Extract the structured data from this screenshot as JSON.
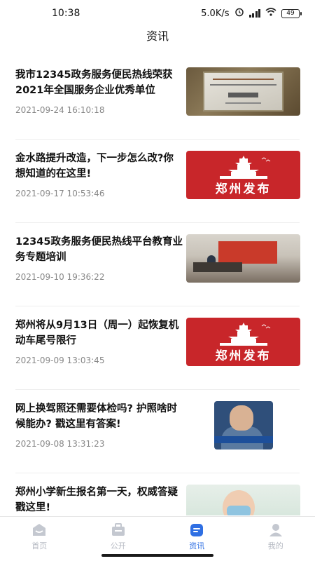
{
  "status_bar": {
    "time": "10:38",
    "net_speed": "5.0K/s",
    "battery": "49"
  },
  "header": {
    "title": "资讯"
  },
  "news": [
    {
      "title": "我市12345政务服务便民热线荣获2021年全国服务企业优秀单位",
      "time": "2021-09-24 16:10:18",
      "thumb": "plaque-photo"
    },
    {
      "title": "金水路提升改造，下一步怎么改?你想知道的在这里!",
      "time": "2021-09-17 10:53:46",
      "thumb": "zhengzhou-release-banner",
      "thumb_text": "郑州发布"
    },
    {
      "title": "12345政务服务便民热线平台教育业务专题培训",
      "time": "2021-09-10 19:36:22",
      "thumb": "meeting-hall-photo"
    },
    {
      "title": "郑州将从9月13日（周一）起恢复机动车尾号限行",
      "time": "2021-09-09 13:03:45",
      "thumb": "zhengzhou-release-banner",
      "thumb_text": "郑州发布"
    },
    {
      "title": "网上换驾照还需要体检吗? 护照啥时候能办? 戳这里有答案!",
      "time": "2021-09-08 13:31:23",
      "thumb": "police-poster"
    },
    {
      "title": "郑州小学新生报名第一天，权威答疑戳这里!",
      "time": "",
      "thumb": "child-photo"
    }
  ],
  "tabbar": {
    "items": [
      {
        "label": "首页",
        "icon": "home-icon"
      },
      {
        "label": "公开",
        "icon": "briefcase-icon"
      },
      {
        "label": "资讯",
        "icon": "news-icon",
        "active": true
      },
      {
        "label": "我的",
        "icon": "user-icon"
      }
    ],
    "active_color": "#2f6fe3",
    "inactive_color": "#b5b9c2"
  },
  "colors": {
    "banner_red": "#c8262a"
  }
}
